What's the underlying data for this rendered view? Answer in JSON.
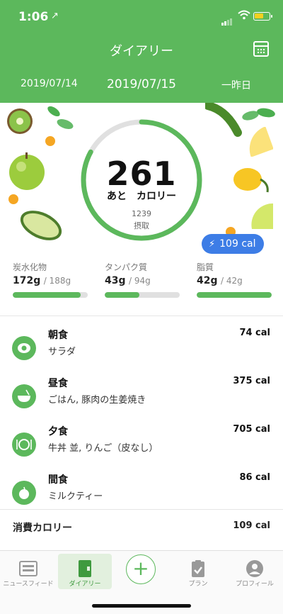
{
  "status_bar": {
    "time": "1:06",
    "location_glyph": "↗"
  },
  "header": {
    "title": "ダイアリー",
    "calendar_icon": "calendar-icon",
    "date_prev": "2019/07/14",
    "date_current": "2019/07/15",
    "date_next": "一昨日"
  },
  "summary": {
    "remaining": "261",
    "remaining_label": "あと　カロリー",
    "intake": "1239",
    "intake_label": "摂取",
    "progress_fraction": 0.83,
    "burn_badge": "109 cal"
  },
  "macros": [
    {
      "name": "炭水化物",
      "value": "172g",
      "target": "/ 188g",
      "fraction": 0.91
    },
    {
      "name": "タンパク質",
      "value": "43g",
      "target": "/ 94g",
      "fraction": 0.46
    },
    {
      "name": "脂質",
      "value": "42g",
      "target": "/ 42g",
      "fraction": 1.0
    }
  ],
  "meals": [
    {
      "name": "朝食",
      "desc": "サラダ",
      "kcal": "74 cal",
      "icon": "egg-icon"
    },
    {
      "name": "昼食",
      "desc": "ごはん, 豚肉の生姜焼き",
      "kcal": "375 cal",
      "icon": "bowl-icon"
    },
    {
      "name": "夕食",
      "desc": "牛丼 並, りんご（皮なし）",
      "kcal": "705 cal",
      "icon": "plate-icon"
    },
    {
      "name": "間食",
      "desc": "ミルクティー",
      "kcal": "86 cal",
      "icon": "apple-icon"
    }
  ],
  "burned": {
    "label": "消費カロリー",
    "kcal": "109 cal"
  },
  "tabs": [
    {
      "label": "ニュースフィード",
      "icon": "news-icon"
    },
    {
      "label": "ダイアリー",
      "icon": "diary-icon"
    },
    {
      "label": "",
      "icon": "add-icon"
    },
    {
      "label": "プラン",
      "icon": "plan-icon"
    },
    {
      "label": "プロフィール",
      "icon": "profile-icon"
    }
  ],
  "colors": {
    "brand_green": "#5cb85c",
    "badge_blue": "#3d7de6",
    "track_gray": "#e0e0e0"
  }
}
